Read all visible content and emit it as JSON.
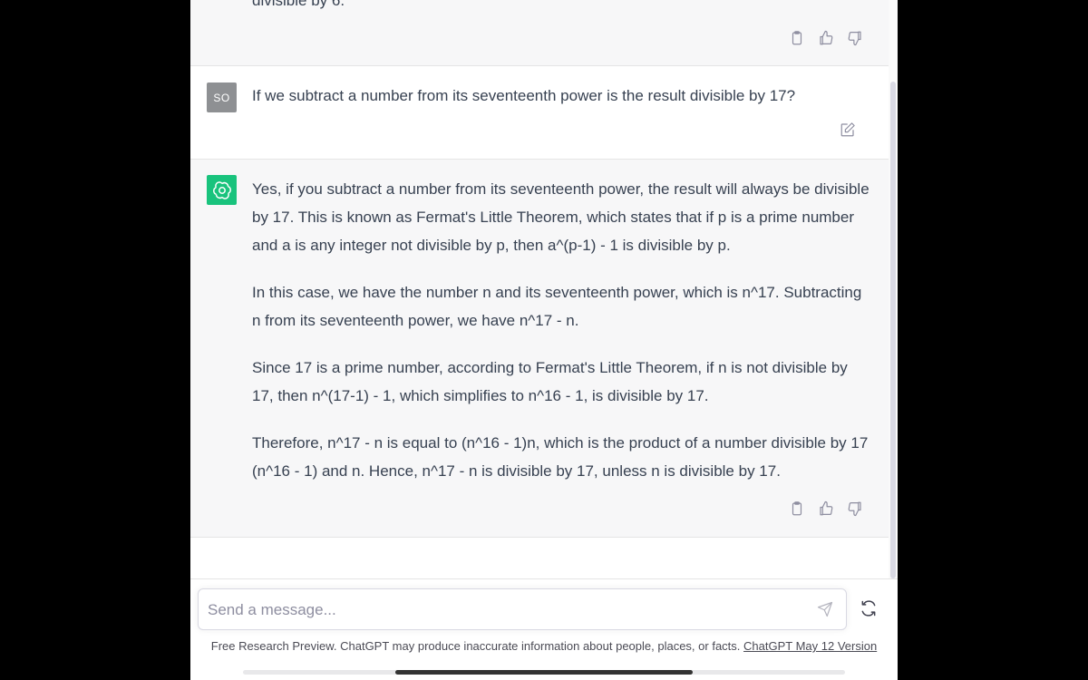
{
  "previous_message": {
    "cut_text": "divisible by 6."
  },
  "user_message": {
    "avatar_initials": "SO",
    "text": "If we subtract a number from its seventeenth power is the result divisible by 17?"
  },
  "assistant_message": {
    "paragraphs": [
      "Yes, if you subtract a number from its seventeenth power, the result will always be divisible by 17. This is known as Fermat's Little Theorem, which states that if p is a prime number and a is any integer not divisible by p, then a^(p-1) - 1 is divisible by p.",
      "In this case, we have the number n and its seventeenth power, which is n^17. Subtracting n from its seventeenth power, we have n^17 - n.",
      "Since 17 is a prime number, according to Fermat's Little Theorem, if n is not divisible by 17, then n^(17-1) - 1, which simplifies to n^16 - 1, is divisible by 17.",
      "Therefore, n^17 - n is equal to (n^16 - 1)n, which is the product of a number divisible by 17 (n^16 - 1) and n. Hence, n^17 - n is divisible by 17, unless n is divisible by 17."
    ]
  },
  "composer": {
    "placeholder": "Send a message..."
  },
  "footer": {
    "text": "Free Research Preview. ChatGPT may produce inaccurate information about people, places, or facts.",
    "link": "ChatGPT May 12 Version"
  },
  "icons": {
    "copy": "clipboard-icon",
    "like": "thumbs-up-icon",
    "dislike": "thumbs-down-icon",
    "edit": "edit-icon",
    "send": "send-icon",
    "regenerate": "regenerate-icon",
    "assistant_logo": "openai-logo-icon"
  },
  "colors": {
    "assistant_bg": "#f7f7f8",
    "assistant_avatar": "#19c37d",
    "user_avatar": "#8e9093",
    "text": "#374151"
  }
}
